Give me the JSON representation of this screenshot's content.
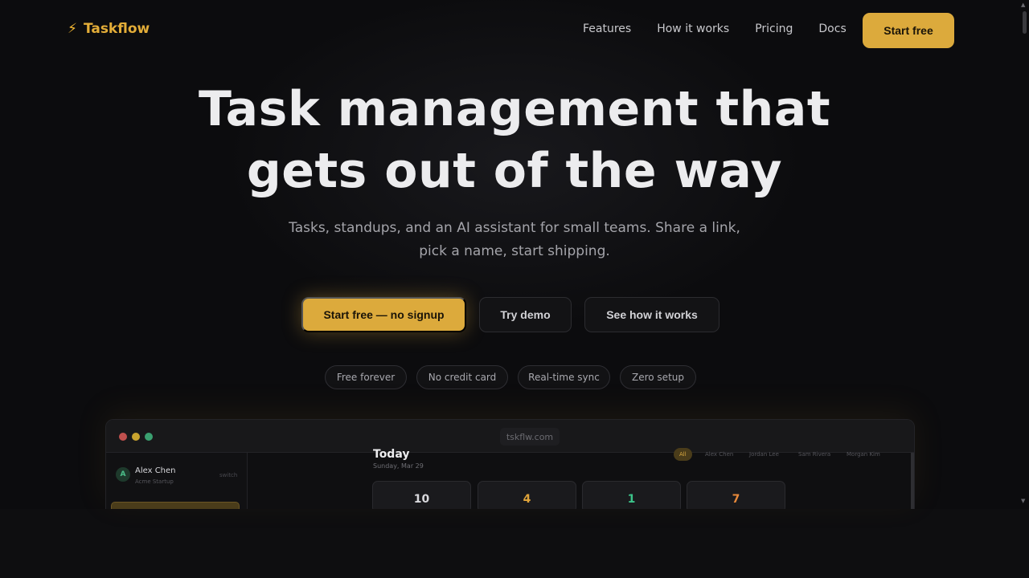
{
  "brand": {
    "name": "Taskflow",
    "icon": "lightning-bolt-icon",
    "accent_color": "#dcaa3c"
  },
  "nav": {
    "links": [
      "Features",
      "How it works",
      "Pricing",
      "Docs"
    ],
    "cta": "Start free"
  },
  "hero": {
    "title_line1": "Task management that",
    "title_line2": "gets out of the way",
    "subtitle_line1": "Tasks, standups, and an AI assistant for small teams. Share a link,",
    "subtitle_line2": "pick a name, start shipping."
  },
  "cta": {
    "primary": "Start free — no signup",
    "demo": "Try demo",
    "how": "See how it works"
  },
  "pills": [
    "Free forever",
    "No credit card",
    "Real-time sync",
    "Zero setup"
  ],
  "preview": {
    "url": "tskflw.com",
    "workspace": {
      "avatar_initial": "A",
      "user": "Alex Chen",
      "org": "Acme Startup",
      "switch": "switch"
    },
    "today": {
      "title": "Today",
      "date": "Sunday, Mar 29"
    },
    "filters": [
      "All",
      "Alex Chen",
      "Jordan Lee",
      "Sam Rivera",
      "Morgan Kim"
    ],
    "stats": [
      {
        "value": "10",
        "color": "#d8d8dc"
      },
      {
        "value": "4",
        "color": "#e0a43a"
      },
      {
        "value": "1",
        "color": "#3cc48a"
      },
      {
        "value": "7",
        "color": "#e8893a"
      }
    ]
  }
}
